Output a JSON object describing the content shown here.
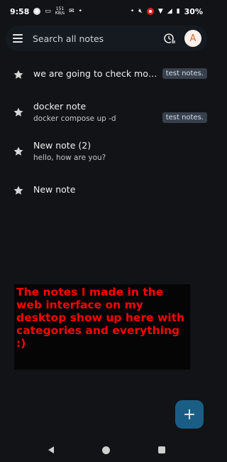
{
  "status_bar": {
    "time": "9:58",
    "network_speed": "151",
    "network_unit": "KB/s",
    "battery": "30%"
  },
  "search": {
    "placeholder": "Search all notes",
    "avatar_letter": "A"
  },
  "notes": [
    {
      "title": "we are going to check mobile ap...",
      "subtitle": "",
      "tag": "test notes."
    },
    {
      "title": "docker note",
      "subtitle": "docker compose up -d",
      "tag": "test notes."
    },
    {
      "title": "New note (2)",
      "subtitle": "hello, how are you?",
      "tag": ""
    },
    {
      "title": "New note",
      "subtitle": "",
      "tag": ""
    }
  ],
  "caption": "The notes I made in the web interface on my desktop show up here with categories and everything :)",
  "fab": {
    "label": "+"
  },
  "colors": {
    "background": "#111316",
    "searchbar": "#151a20",
    "tag_bg": "#37404c",
    "fab": "#1a5e86",
    "caption_text": "#ff0000"
  }
}
